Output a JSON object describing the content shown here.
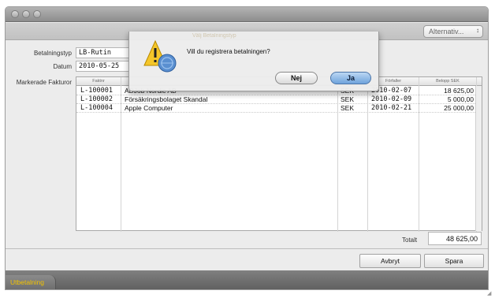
{
  "window": {
    "title": ""
  },
  "toolbar": {
    "options_label": "Alternativ..."
  },
  "form": {
    "betalningstyp_label": "Betalningstyp",
    "betalningstyp_value": "LB-Rutin",
    "datum_label": "Datum",
    "datum_value": "2010-05-25",
    "markerade_label": "Markerade Fakturor"
  },
  "table": {
    "headers": [
      "Faktnr",
      "",
      "",
      "Förfaller",
      "Belopp SEK"
    ],
    "rows": [
      {
        "faktnr": "L-100001",
        "namn": "ADJob Nordic AB",
        "valuta": "SEK",
        "forfaller": "2010-02-07",
        "belopp": "18 625,00"
      },
      {
        "faktnr": "L-100002",
        "namn": "Försäkringsbolaget Skandal",
        "valuta": "SEK",
        "forfaller": "2010-02-09",
        "belopp": "5 000,00"
      },
      {
        "faktnr": "L-100004",
        "namn": "Apple Computer",
        "valuta": "SEK",
        "forfaller": "2010-02-21",
        "belopp": "25 000,00"
      }
    ]
  },
  "totals": {
    "label": "Totalt",
    "value": "48 625,00"
  },
  "buttons": {
    "cancel": "Avbryt",
    "save": "Spara"
  },
  "bottom_tab": {
    "label": "Utbetalning"
  },
  "dialog": {
    "title": "Välj Betalningstyp",
    "message": "Vill du registrera betalningen?",
    "no_label": "Nej",
    "yes_label": "Ja",
    "icon": "warning-icon"
  },
  "colors": {
    "accent_tab_text": "#f2c200",
    "default_button": "#6fa3dc"
  }
}
